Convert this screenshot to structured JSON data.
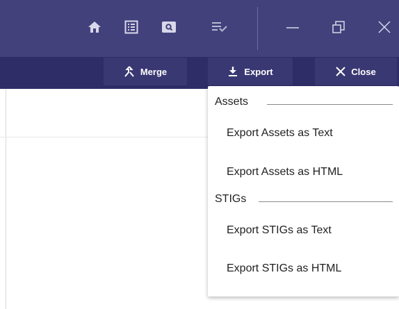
{
  "titlebar": {
    "icons": [
      "home-icon",
      "list-icon",
      "search-icon",
      "checklist-icon",
      "minimize-icon",
      "restore-icon",
      "close-icon"
    ]
  },
  "toolbar": {
    "merge_label": "Merge",
    "export_label": "Export",
    "close_label": "Close"
  },
  "export_menu": {
    "groups": [
      {
        "label": "Assets",
        "items": [
          "Export Assets as Text",
          "Export Assets as HTML"
        ]
      },
      {
        "label": "STIGs",
        "items": [
          "Export STIGs as Text",
          "Export STIGs as HTML"
        ]
      }
    ]
  },
  "colors": {
    "titlebar": "#43417c",
    "toolbar": "#2f2d68",
    "button": "#3a3873"
  }
}
